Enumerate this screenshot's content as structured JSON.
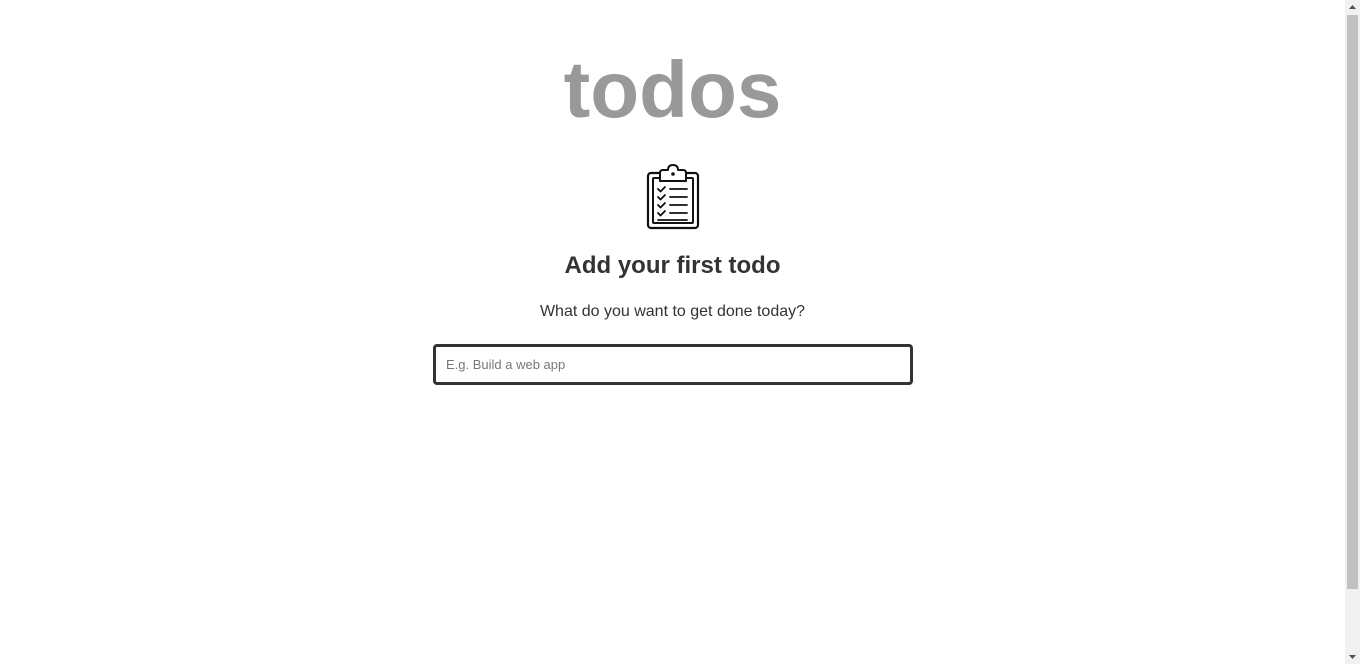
{
  "app": {
    "title": "todos"
  },
  "empty_state": {
    "icon": "clipboard-checklist-icon",
    "heading": "Add your first todo",
    "subtitle": "What do you want to get done today?"
  },
  "new_todo": {
    "value": "",
    "placeholder": "E.g. Build a web app"
  },
  "colors": {
    "title": "#999999",
    "text": "#333333",
    "input_border": "#333333",
    "scrollbar_thumb": "#c1c1c1",
    "scrollbar_track": "#f1f1f1"
  }
}
